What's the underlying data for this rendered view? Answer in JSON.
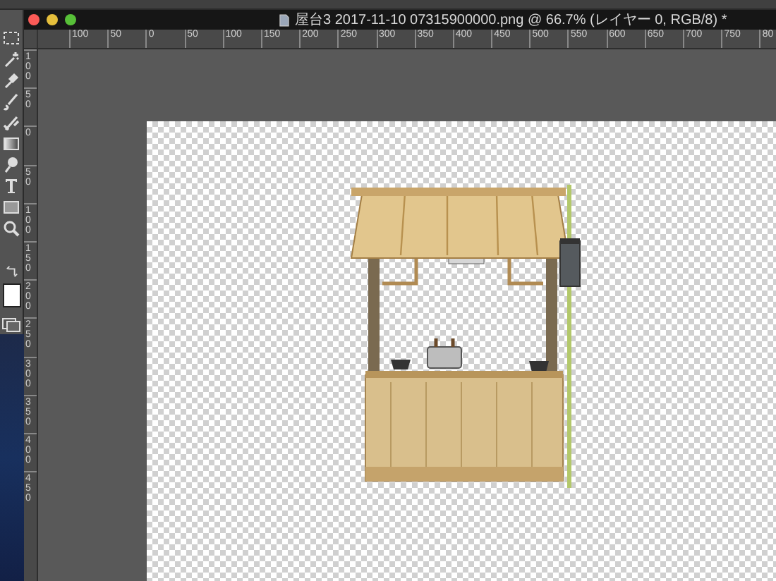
{
  "window": {
    "title": "屋台3 2017-11-10 07315900000.png @ 66.7% (レイヤー 0, RGB/8) *"
  },
  "rulers": {
    "horizontal": [
      "100",
      "50",
      "0",
      "50",
      "100",
      "150",
      "200",
      "250",
      "300",
      "350",
      "400",
      "450",
      "500",
      "550",
      "600",
      "650",
      "700",
      "750",
      "80"
    ],
    "vertical": [
      "100",
      "50",
      "0",
      "50",
      "100",
      "150",
      "200",
      "250",
      "300",
      "350",
      "400",
      "450"
    ]
  }
}
